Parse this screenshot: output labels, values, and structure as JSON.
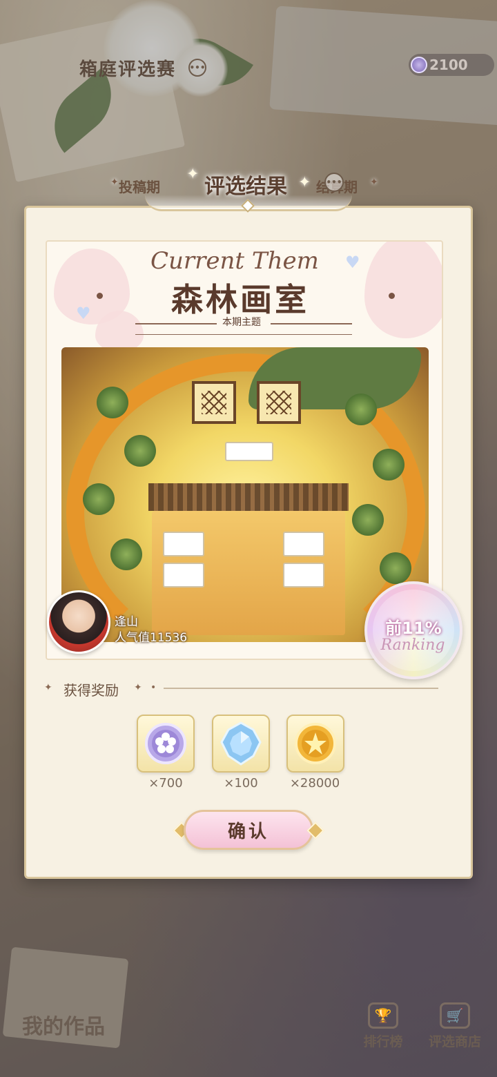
{
  "header": {
    "title": "箱庭评选赛",
    "currency_value": "2100",
    "menu_icon": "more-dots-icon",
    "currency_icon": "flower-coin-icon"
  },
  "phases": {
    "left": "投稿期",
    "current": "评选结果",
    "right": "结算期"
  },
  "theme": {
    "english": "Current Them",
    "title": "森林画室",
    "subtitle": "本期主题"
  },
  "entry": {
    "author_name": "逢山",
    "popularity": "人气值11536",
    "ranking_value": "前11%",
    "ranking_label": "Ranking"
  },
  "rewards": {
    "title": "获得奖励",
    "items": [
      {
        "icon": "flower-coin-icon",
        "quantity": "×700"
      },
      {
        "icon": "crystal-icon",
        "quantity": "×100"
      },
      {
        "icon": "star-coin-icon",
        "quantity": "×28000"
      }
    ]
  },
  "confirm_label": "确认",
  "bottom_nav": {
    "my_works": "我的作品",
    "leaderboard": "排行榜",
    "shop": "评选商店"
  },
  "colors": {
    "panel_bg": "#f7f1e3",
    "panel_border": "#d9c69c",
    "title_brown": "#5a3a2c",
    "confirm_pink": "#f4c2d6"
  }
}
